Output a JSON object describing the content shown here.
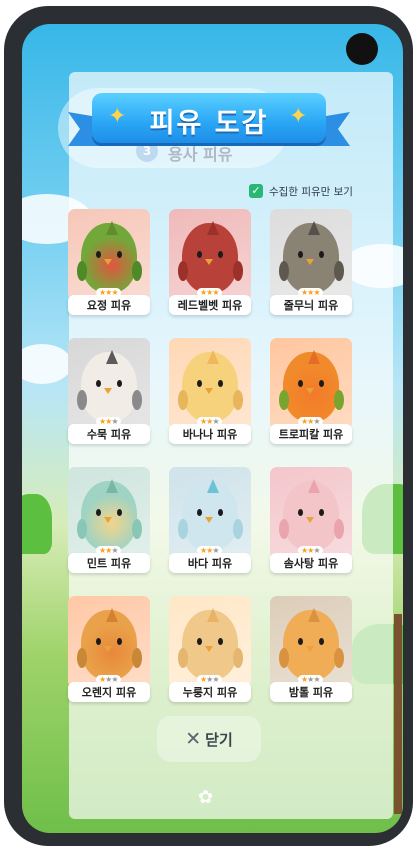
{
  "title": "피유 도감",
  "background_text": {
    "badge": "3",
    "label": "용사 피유"
  },
  "filter": {
    "checked": true,
    "label": "수집한 피유만 보기"
  },
  "cards": [
    {
      "name": "요정 피유",
      "stars": 3,
      "bg": "#f6c7b8",
      "body": "#72a83a",
      "face": "#e2553f",
      "crest": "#5f8d2d",
      "wing": "#4f8a28"
    },
    {
      "name": "레드벨벳 피유",
      "stars": 3,
      "bg": "#f0b9b9",
      "body": "#b8423a",
      "face": "#b8423a",
      "crest": "#9b3129",
      "wing": "#9b3129"
    },
    {
      "name": "줄무늬 피유",
      "stars": 3,
      "bg": "#dcdcdc",
      "body": "#8a8273",
      "face": "#8a8273",
      "crest": "#555049",
      "wing": "#5e594f"
    },
    {
      "name": "수묵 피유",
      "stars": 2,
      "bg": "#d7d7d7",
      "body": "#f1ece6",
      "face": "#f1ece6",
      "crest": "#5b5b5b",
      "wing": "#8a8a8a"
    },
    {
      "name": "바나나 피유",
      "stars": 2,
      "bg": "#ffd8b6",
      "body": "#f6d27d",
      "face": "#f6d27d",
      "crest": "#efb85a",
      "wing": "#e6b55c"
    },
    {
      "name": "트로피칼 피유",
      "stars": 2,
      "bg": "#ffc69e",
      "body": "#f18a2a",
      "face": "#f27a2a",
      "crest": "#e46c24",
      "wing": "#79a52e"
    },
    {
      "name": "민트 피유",
      "stars": 2,
      "bg": "#cfe5de",
      "body": "#9fd3c3",
      "face": "#f3d48c",
      "crest": "#78b7a4",
      "wing": "#8ac6b6"
    },
    {
      "name": "바다 피유",
      "stars": 2,
      "bg": "#cfe3ea",
      "body": "#cfe6ee",
      "face": "#cfe6ee",
      "crest": "#6dc3d6",
      "wing": "#a9d3df"
    },
    {
      "name": "솜사탕 피유",
      "stars": 2,
      "bg": "#f3c6cb",
      "body": "#f3c5c9",
      "face": "#f3c5c9",
      "crest": "#e9a4ad",
      "wing": "#e9a4ad"
    },
    {
      "name": "오렌지 피유",
      "stars": 1,
      "bg": "#ffc8a6",
      "body": "#e9a24a",
      "face": "#e8883a",
      "crest": "#d58230",
      "wing": "#c88837"
    },
    {
      "name": "누룽지 피유",
      "stars": 1,
      "bg": "#ffe7c7",
      "body": "#f0c98a",
      "face": "#f0c98a",
      "crest": "#e9b266",
      "wing": "#e5b670"
    },
    {
      "name": "밤톨 피유",
      "stars": 1,
      "bg": "#dccdb8",
      "body": "#f0ad55",
      "face": "#f0ad55",
      "crest": "#d99240",
      "wing": "#d99240"
    }
  ],
  "close": {
    "label": "닫기"
  }
}
